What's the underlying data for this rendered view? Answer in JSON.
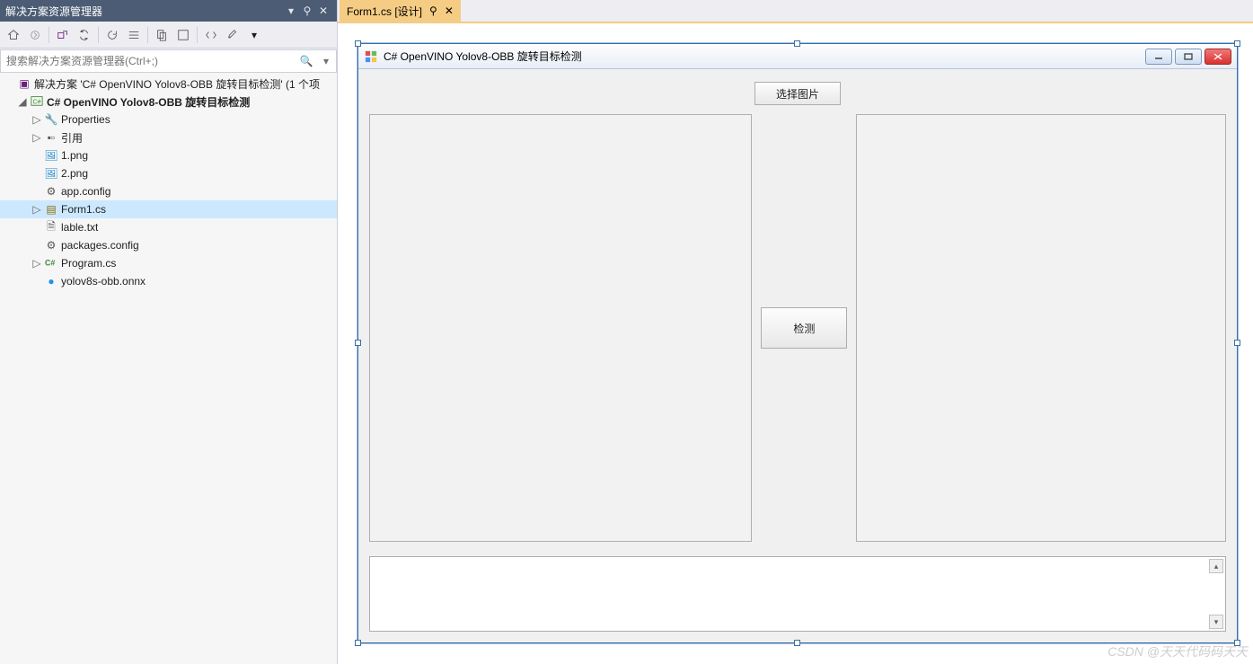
{
  "solutionExplorer": {
    "title": "解决方案资源管理器",
    "searchPlaceholder": "搜索解决方案资源管理器(Ctrl+;)",
    "solutionLine": "解决方案 'C# OpenVINO Yolov8-OBB 旋转目标检测' (1 个项",
    "projectName": "C# OpenVINO Yolov8-OBB 旋转目标检测",
    "items": {
      "properties": "Properties",
      "references": "引用",
      "png1": "1.png",
      "png2": "2.png",
      "appconfig": "app.config",
      "form1": "Form1.cs",
      "labletxt": "lable.txt",
      "packages": "packages.config",
      "program": "Program.cs",
      "onnx": "yolov8s-obb.onnx"
    }
  },
  "tab": {
    "label": "Form1.cs [设计]"
  },
  "form": {
    "title": "C# OpenVINO Yolov8-OBB 旋转目标检测",
    "selectImage": "选择图片",
    "detect": "检测"
  },
  "watermark": "CSDN @天天代码码天天"
}
